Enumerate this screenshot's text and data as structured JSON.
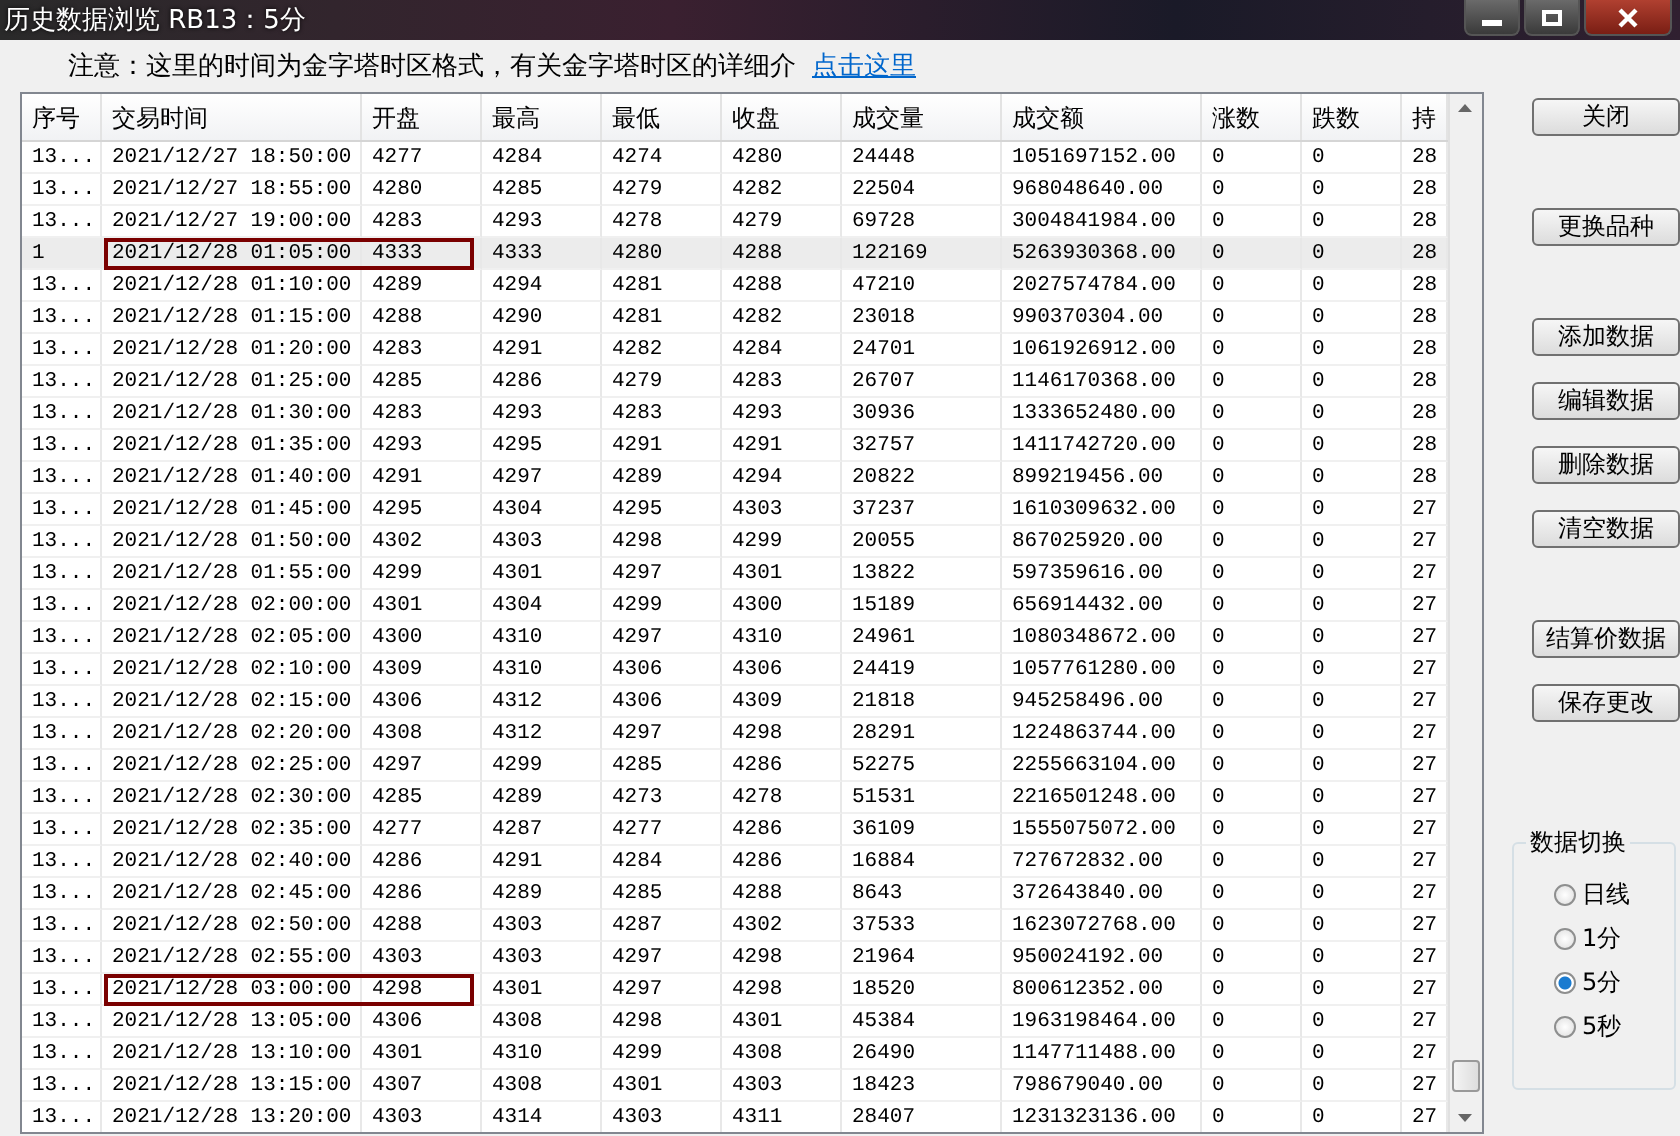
{
  "window": {
    "title": "历史数据浏览 RB13：5分"
  },
  "notice": {
    "text": "注意：这里的时间为金字塔时区格式，有关金字塔时区的详细介",
    "link": "点击这里"
  },
  "table": {
    "columns": [
      "序号",
      "交易时间",
      "开盘",
      "最高",
      "最低",
      "收盘",
      "成交量",
      "成交额",
      "涨数",
      "跌数",
      "持"
    ],
    "rows": [
      {
        "cells": [
          "13...",
          "2021/12/27 18:50:00",
          "4277",
          "4284",
          "4274",
          "4280",
          "24448",
          "1051697152.00",
          "0",
          "0",
          "28"
        ],
        "selected": false,
        "marked": false
      },
      {
        "cells": [
          "13...",
          "2021/12/27 18:55:00",
          "4280",
          "4285",
          "4279",
          "4282",
          "22504",
          "968048640.00",
          "0",
          "0",
          "28"
        ],
        "selected": false,
        "marked": false
      },
      {
        "cells": [
          "13...",
          "2021/12/27 19:00:00",
          "4283",
          "4293",
          "4278",
          "4279",
          "69728",
          "3004841984.00",
          "0",
          "0",
          "28"
        ],
        "selected": false,
        "marked": false
      },
      {
        "cells": [
          "1",
          "2021/12/28 01:05:00",
          "4333",
          "4333",
          "4280",
          "4288",
          "122169",
          "5263930368.00",
          "0",
          "0",
          "28"
        ],
        "selected": true,
        "marked": true
      },
      {
        "cells": [
          "13...",
          "2021/12/28 01:10:00",
          "4289",
          "4294",
          "4281",
          "4288",
          "47210",
          "2027574784.00",
          "0",
          "0",
          "28"
        ],
        "selected": false,
        "marked": false
      },
      {
        "cells": [
          "13...",
          "2021/12/28 01:15:00",
          "4288",
          "4290",
          "4281",
          "4282",
          "23018",
          "990370304.00",
          "0",
          "0",
          "28"
        ],
        "selected": false,
        "marked": false
      },
      {
        "cells": [
          "13...",
          "2021/12/28 01:20:00",
          "4283",
          "4291",
          "4282",
          "4284",
          "24701",
          "1061926912.00",
          "0",
          "0",
          "28"
        ],
        "selected": false,
        "marked": false
      },
      {
        "cells": [
          "13...",
          "2021/12/28 01:25:00",
          "4285",
          "4286",
          "4279",
          "4283",
          "26707",
          "1146170368.00",
          "0",
          "0",
          "28"
        ],
        "selected": false,
        "marked": false
      },
      {
        "cells": [
          "13...",
          "2021/12/28 01:30:00",
          "4283",
          "4293",
          "4283",
          "4293",
          "30936",
          "1333652480.00",
          "0",
          "0",
          "28"
        ],
        "selected": false,
        "marked": false
      },
      {
        "cells": [
          "13...",
          "2021/12/28 01:35:00",
          "4293",
          "4295",
          "4291",
          "4291",
          "32757",
          "1411742720.00",
          "0",
          "0",
          "28"
        ],
        "selected": false,
        "marked": false
      },
      {
        "cells": [
          "13...",
          "2021/12/28 01:40:00",
          "4291",
          "4297",
          "4289",
          "4294",
          "20822",
          "899219456.00",
          "0",
          "0",
          "28"
        ],
        "selected": false,
        "marked": false
      },
      {
        "cells": [
          "13...",
          "2021/12/28 01:45:00",
          "4295",
          "4304",
          "4295",
          "4303",
          "37237",
          "1610309632.00",
          "0",
          "0",
          "27"
        ],
        "selected": false,
        "marked": false
      },
      {
        "cells": [
          "13...",
          "2021/12/28 01:50:00",
          "4302",
          "4303",
          "4298",
          "4299",
          "20055",
          "867025920.00",
          "0",
          "0",
          "27"
        ],
        "selected": false,
        "marked": false
      },
      {
        "cells": [
          "13...",
          "2021/12/28 01:55:00",
          "4299",
          "4301",
          "4297",
          "4301",
          "13822",
          "597359616.00",
          "0",
          "0",
          "27"
        ],
        "selected": false,
        "marked": false
      },
      {
        "cells": [
          "13...",
          "2021/12/28 02:00:00",
          "4301",
          "4304",
          "4299",
          "4300",
          "15189",
          "656914432.00",
          "0",
          "0",
          "27"
        ],
        "selected": false,
        "marked": false
      },
      {
        "cells": [
          "13...",
          "2021/12/28 02:05:00",
          "4300",
          "4310",
          "4297",
          "4310",
          "24961",
          "1080348672.00",
          "0",
          "0",
          "27"
        ],
        "selected": false,
        "marked": false
      },
      {
        "cells": [
          "13...",
          "2021/12/28 02:10:00",
          "4309",
          "4310",
          "4306",
          "4306",
          "24419",
          "1057761280.00",
          "0",
          "0",
          "27"
        ],
        "selected": false,
        "marked": false
      },
      {
        "cells": [
          "13...",
          "2021/12/28 02:15:00",
          "4306",
          "4312",
          "4306",
          "4309",
          "21818",
          "945258496.00",
          "0",
          "0",
          "27"
        ],
        "selected": false,
        "marked": false
      },
      {
        "cells": [
          "13...",
          "2021/12/28 02:20:00",
          "4308",
          "4312",
          "4297",
          "4298",
          "28291",
          "1224863744.00",
          "0",
          "0",
          "27"
        ],
        "selected": false,
        "marked": false
      },
      {
        "cells": [
          "13...",
          "2021/12/28 02:25:00",
          "4297",
          "4299",
          "4285",
          "4286",
          "52275",
          "2255663104.00",
          "0",
          "0",
          "27"
        ],
        "selected": false,
        "marked": false
      },
      {
        "cells": [
          "13...",
          "2021/12/28 02:30:00",
          "4285",
          "4289",
          "4273",
          "4278",
          "51531",
          "2216501248.00",
          "0",
          "0",
          "27"
        ],
        "selected": false,
        "marked": false
      },
      {
        "cells": [
          "13...",
          "2021/12/28 02:35:00",
          "4277",
          "4287",
          "4277",
          "4286",
          "36109",
          "1555075072.00",
          "0",
          "0",
          "27"
        ],
        "selected": false,
        "marked": false
      },
      {
        "cells": [
          "13...",
          "2021/12/28 02:40:00",
          "4286",
          "4291",
          "4284",
          "4286",
          "16884",
          "727672832.00",
          "0",
          "0",
          "27"
        ],
        "selected": false,
        "marked": false
      },
      {
        "cells": [
          "13...",
          "2021/12/28 02:45:00",
          "4286",
          "4289",
          "4285",
          "4288",
          "8643",
          "372643840.00",
          "0",
          "0",
          "27"
        ],
        "selected": false,
        "marked": false
      },
      {
        "cells": [
          "13...",
          "2021/12/28 02:50:00",
          "4288",
          "4303",
          "4287",
          "4302",
          "37533",
          "1623072768.00",
          "0",
          "0",
          "27"
        ],
        "selected": false,
        "marked": false
      },
      {
        "cells": [
          "13...",
          "2021/12/28 02:55:00",
          "4303",
          "4303",
          "4297",
          "4298",
          "21964",
          "950024192.00",
          "0",
          "0",
          "27"
        ],
        "selected": false,
        "marked": false
      },
      {
        "cells": [
          "13...",
          "2021/12/28 03:00:00",
          "4298",
          "4301",
          "4297",
          "4298",
          "18520",
          "800612352.00",
          "0",
          "0",
          "27"
        ],
        "selected": false,
        "marked": true
      },
      {
        "cells": [
          "13...",
          "2021/12/28 13:05:00",
          "4306",
          "4308",
          "4298",
          "4301",
          "45384",
          "1963198464.00",
          "0",
          "0",
          "27"
        ],
        "selected": false,
        "marked": false
      },
      {
        "cells": [
          "13...",
          "2021/12/28 13:10:00",
          "4301",
          "4310",
          "4299",
          "4308",
          "26490",
          "1147711488.00",
          "0",
          "0",
          "27"
        ],
        "selected": false,
        "marked": false
      },
      {
        "cells": [
          "13...",
          "2021/12/28 13:15:00",
          "4307",
          "4308",
          "4301",
          "4303",
          "18423",
          "798679040.00",
          "0",
          "0",
          "27"
        ],
        "selected": false,
        "marked": false
      },
      {
        "cells": [
          "13...",
          "2021/12/28 13:20:00",
          "4303",
          "4314",
          "4303",
          "4311",
          "28407",
          "1231323136.00",
          "0",
          "0",
          "27"
        ],
        "selected": false,
        "marked": false
      }
    ]
  },
  "buttons": [
    "关闭",
    "更换品种",
    "添加数据",
    "编辑数据",
    "删除数据",
    "清空数据",
    "结算价数据",
    "保存更改"
  ],
  "data_switch": {
    "title": "数据切换",
    "options": [
      {
        "label": "日线",
        "selected": false
      },
      {
        "label": "1分",
        "selected": false
      },
      {
        "label": "5分",
        "selected": true
      },
      {
        "label": "5秒",
        "selected": false
      }
    ]
  }
}
